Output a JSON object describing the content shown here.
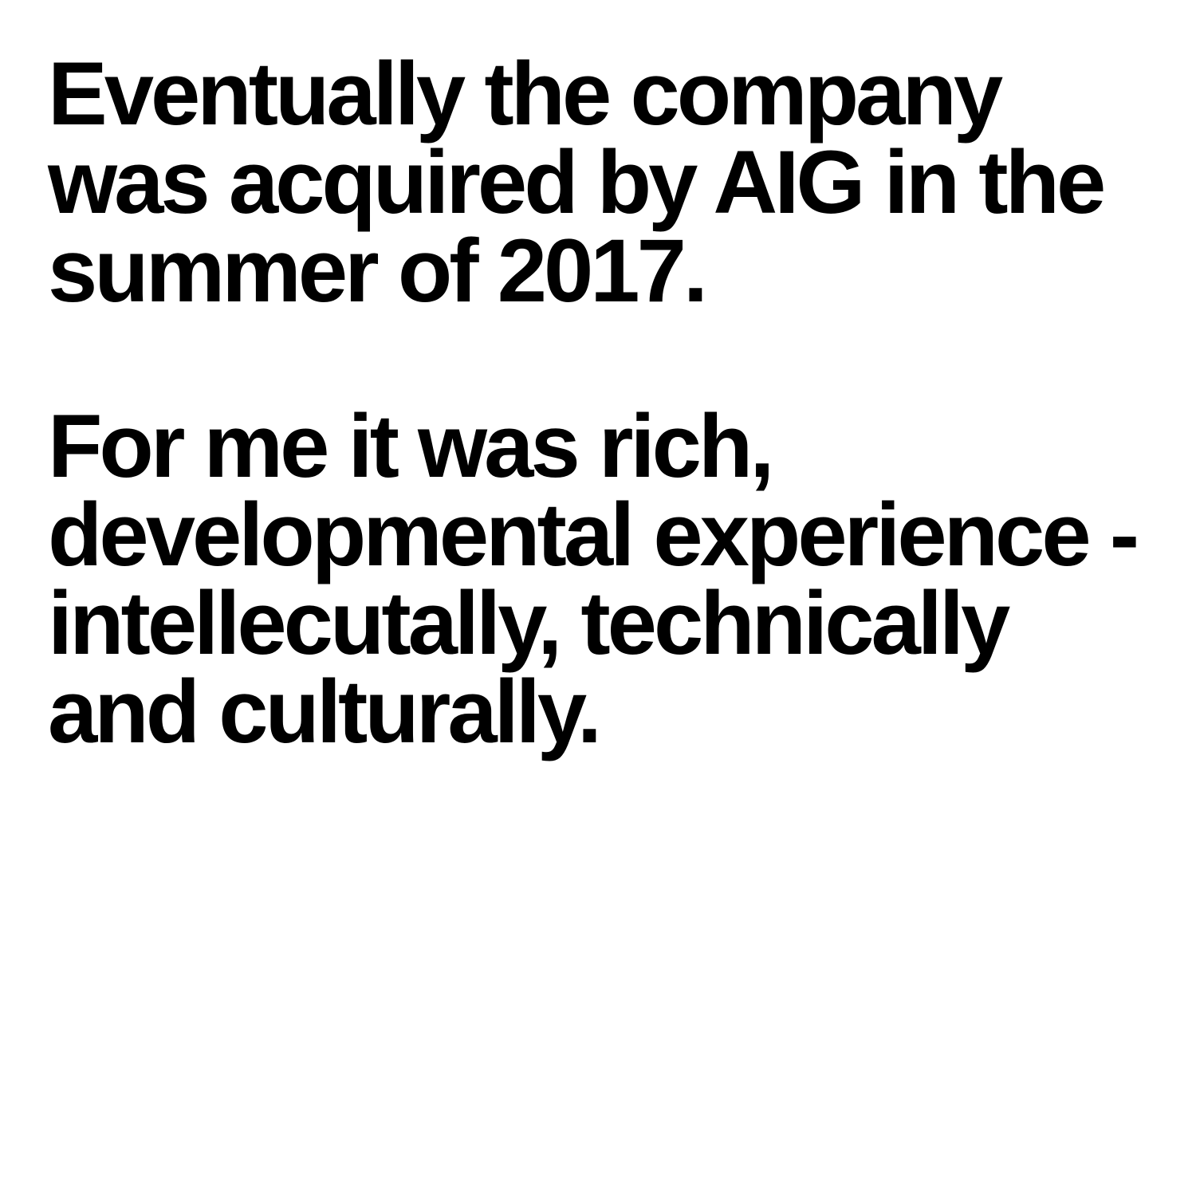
{
  "paragraphs": [
    {
      "lines": [
        "Eventually the company",
        "was acquired by AIG in the",
        "summer of 2017."
      ]
    },
    {
      "lines": [
        "For me it was rich,",
        "developmental experience -",
        "intellecutally, technically",
        "and culturally."
      ]
    }
  ],
  "colors": {
    "background": "#ffffff",
    "text": "#000000"
  }
}
